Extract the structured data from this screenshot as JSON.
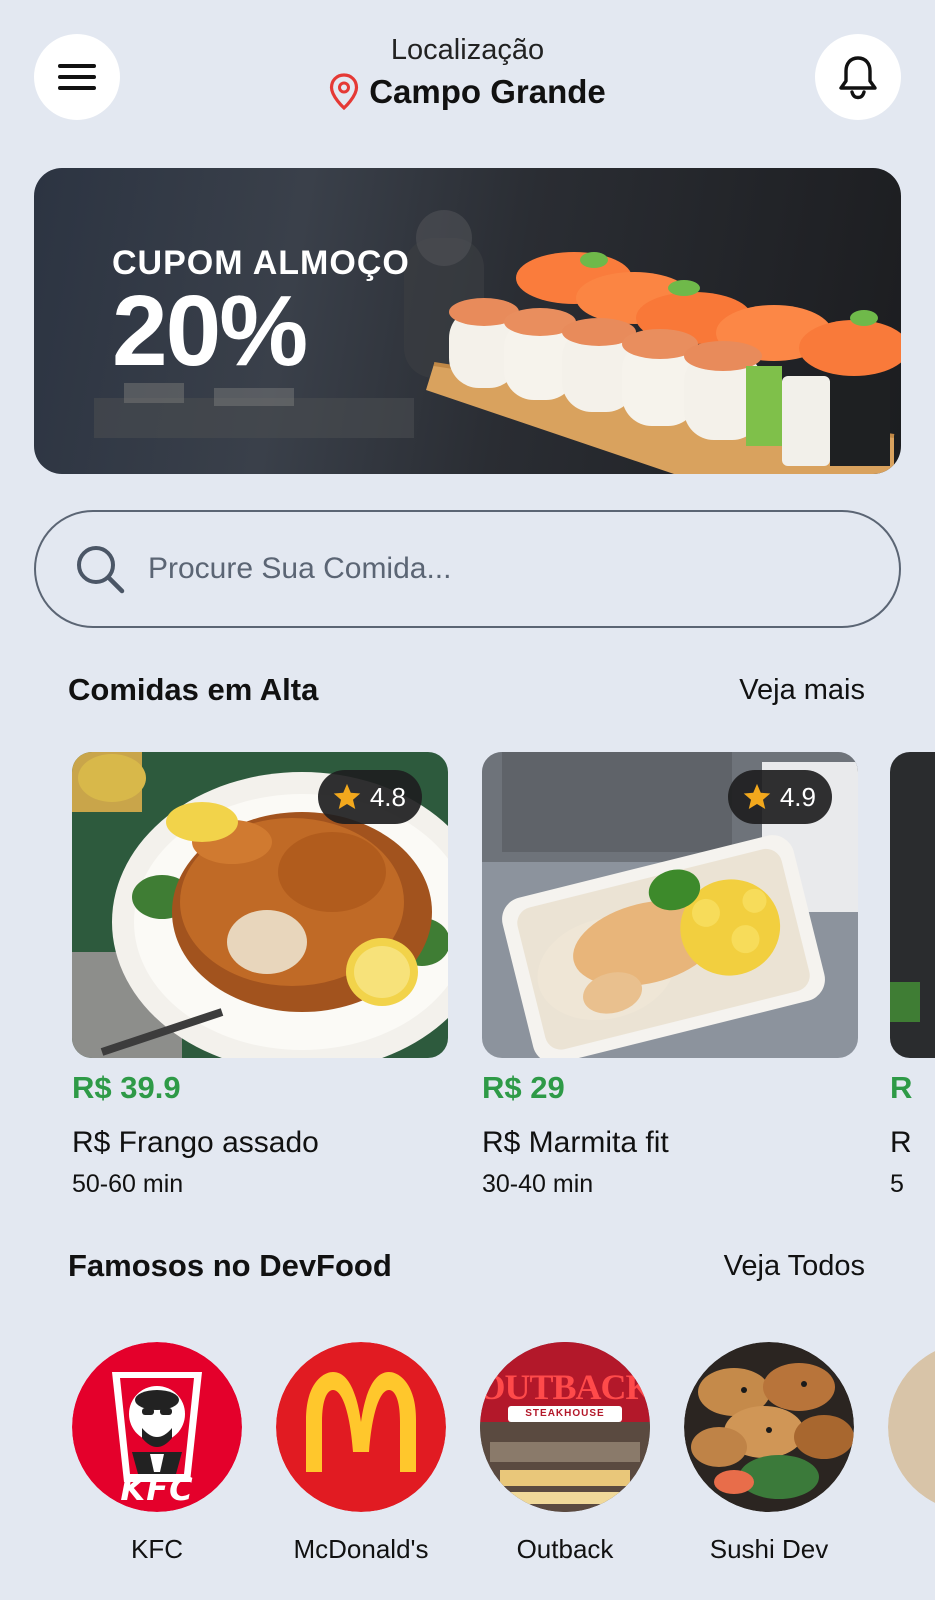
{
  "header": {
    "location_label": "Localização",
    "city": "Campo Grande",
    "menu_icon": "hamburger-menu-icon",
    "bell_icon": "bell-icon",
    "pin_color": "#e53935"
  },
  "banner": {
    "subtitle": "CUPOM ALMOÇO",
    "percent": "20%"
  },
  "search": {
    "placeholder": "Procure Sua Comida..."
  },
  "trending": {
    "title": "Comidas em Alta",
    "link": "Veja mais",
    "items": [
      {
        "price": "R$ 39.9",
        "name": "R$ Frango assado",
        "time": "50-60 min",
        "rating": "4.8"
      },
      {
        "price": "R$ 29",
        "name": "R$ Marmita fit",
        "time": "30-40 min",
        "rating": "4.9"
      },
      {
        "price": "R",
        "name": "R",
        "time": "5"
      }
    ]
  },
  "famous": {
    "title": "Famosos no DevFood",
    "link": "Veja Todos",
    "restaurants": [
      {
        "name": "KFC",
        "logo_text": "KFC"
      },
      {
        "name": "McDonald's"
      },
      {
        "name": "Outback",
        "logo_text": "OUTBACK",
        "logo_sub": "STEAKHOUSE"
      },
      {
        "name": "Sushi Dev"
      }
    ]
  },
  "colors": {
    "background": "#e3e8f1",
    "price_green": "#2e9a47",
    "star": "#f2a81d",
    "kfc_red": "#e4002b",
    "mcd_red": "#e11b22",
    "mcd_yellow": "#ffc72c"
  }
}
